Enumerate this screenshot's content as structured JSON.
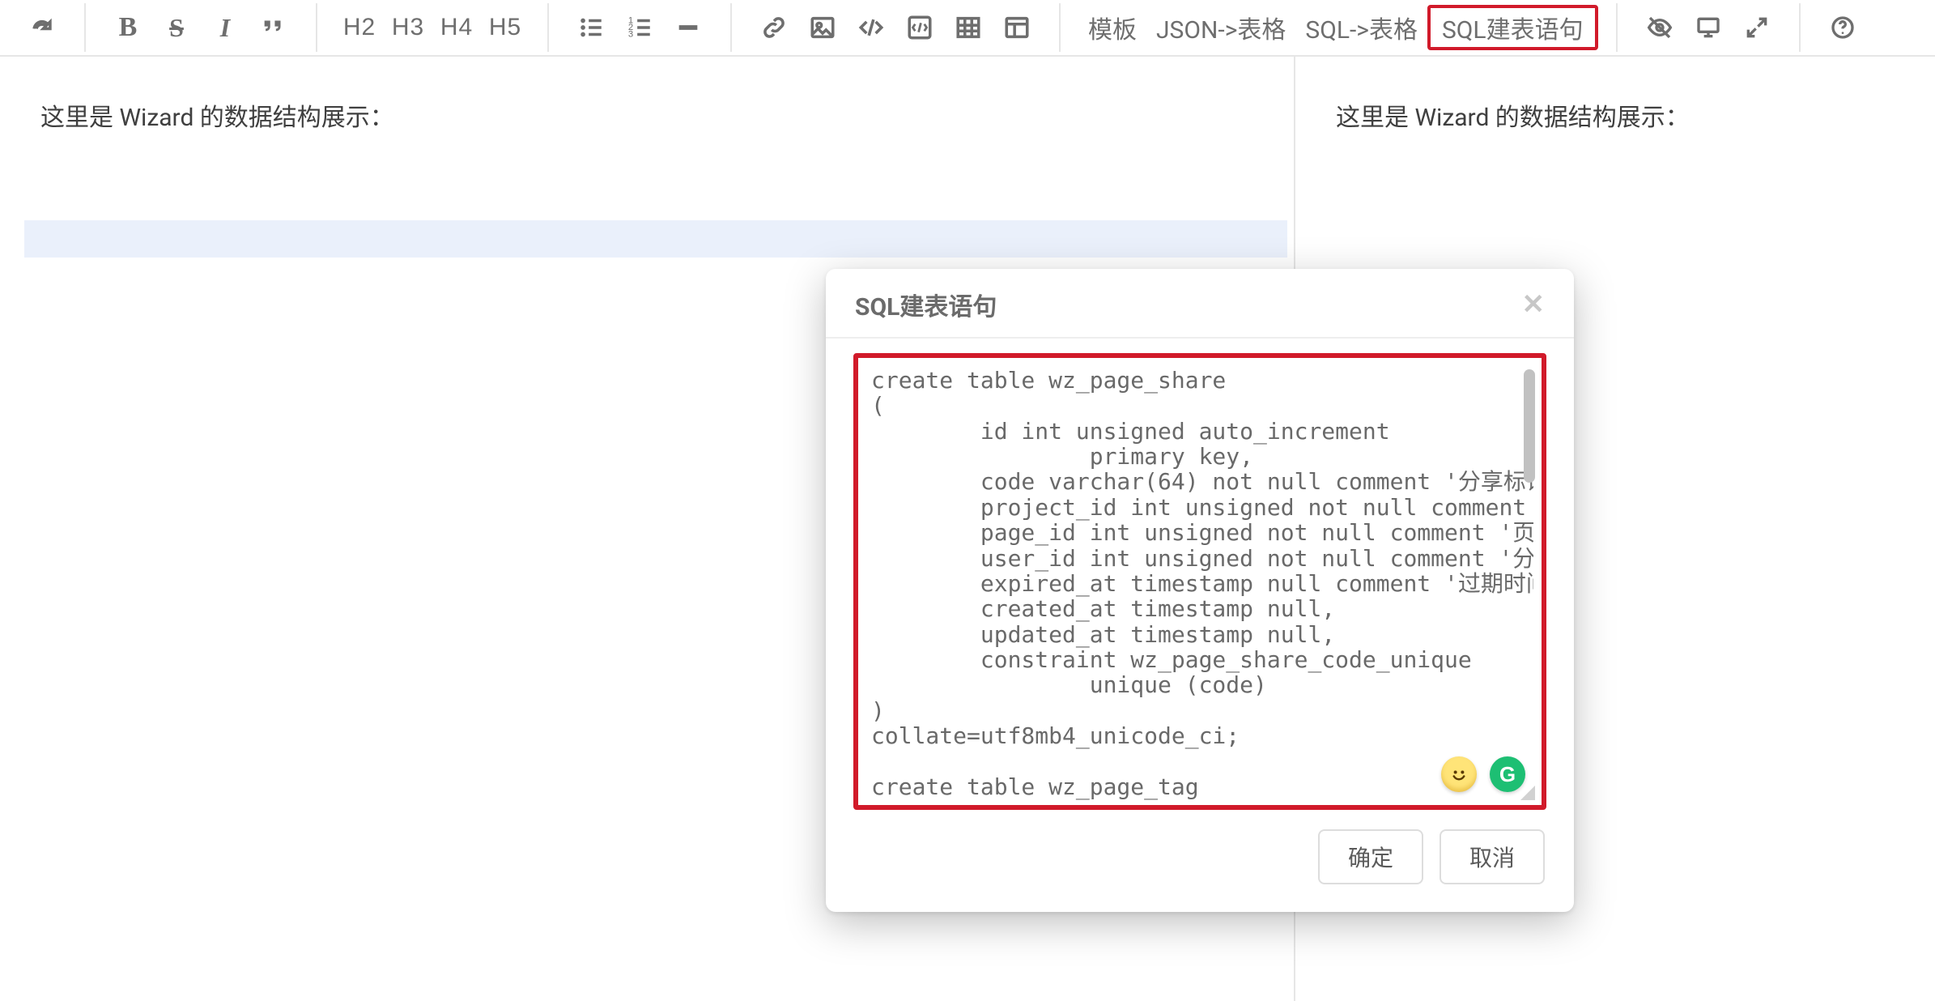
{
  "toolbar": {
    "bold": "B",
    "strike": "S",
    "italic": "I",
    "h2": "H2",
    "h3": "H3",
    "h4": "H4",
    "h5": "H5",
    "template": "模板",
    "json2table": "JSON->表格",
    "sql2table": "SQL->表格",
    "sql_create": "SQL建表语句"
  },
  "editor": {
    "left_intro": "这里是 Wizard 的数据结构展示：",
    "right_intro": "这里是 Wizard 的数据结构展示："
  },
  "modal": {
    "title": "SQL建表语句",
    "sql": "create table wz_page_share\n(\n        id int unsigned auto_increment\n                primary key,\n        code varchar(64) not null comment '分享标识',\n        project_id int unsigned not null comment '项目ID',\n        page_id int unsigned not null comment '页面ID',\n        user_id int unsigned not null comment '分享人ID',\n        expired_at timestamp null comment '过期时间',\n        created_at timestamp null,\n        updated_at timestamp null,\n        constraint wz_page_share_code_unique\n                unique (code)\n)\ncollate=utf8mb4_unicode_ci;\n\ncreate table wz_page_tag",
    "grammarly_letter": "G",
    "confirm": "确定",
    "cancel": "取消"
  }
}
